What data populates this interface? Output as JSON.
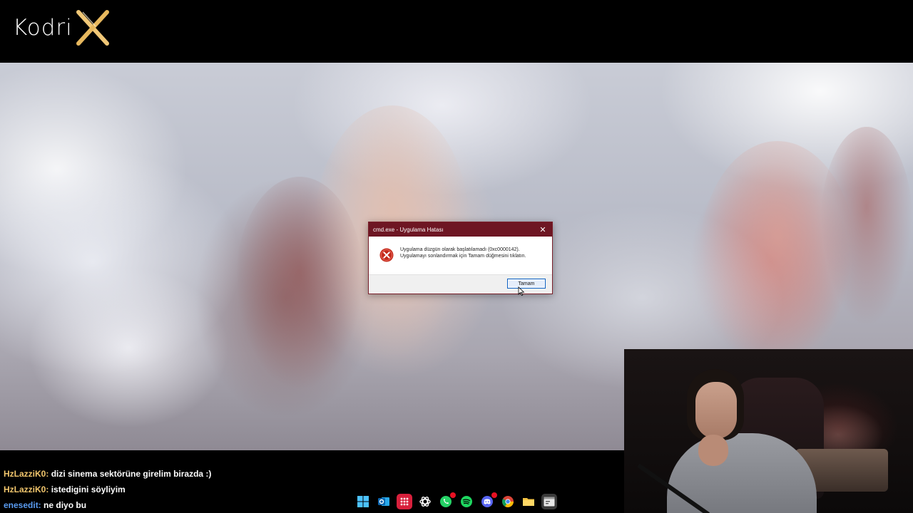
{
  "brand": {
    "logo_text": "Kodri",
    "logo_letter": "X",
    "accent_color": "#f0c777"
  },
  "dialog": {
    "title": "cmd.exe - Uygulama Hatası",
    "close_glyph": "✕",
    "icon": "error-icon",
    "message_line1": "Uygulama düzgün olarak başlatılamadı (0xc0000142).",
    "message_line2": "Uygulamayı sonlandırmak için Tamam düğmesini tıklatın.",
    "ok_label": "Tamam",
    "title_color": "#6e1623"
  },
  "chat": [
    {
      "user": "HzLazziK0:",
      "message": "dizi sinema sektörüne girelim birazda :)"
    },
    {
      "user": "HzLazziK0:",
      "message": "istedigini söyliyim"
    },
    {
      "user": "enesedit:",
      "message": "ne diyo bu"
    }
  ],
  "taskbar": {
    "icons": [
      "windows-start-icon",
      "outlook-icon",
      "app-grid-icon",
      "chatgpt-icon",
      "whatsapp-icon",
      "spotify-icon",
      "discord-icon",
      "chrome-icon",
      "file-explorer-icon",
      "terminal-icon"
    ]
  }
}
